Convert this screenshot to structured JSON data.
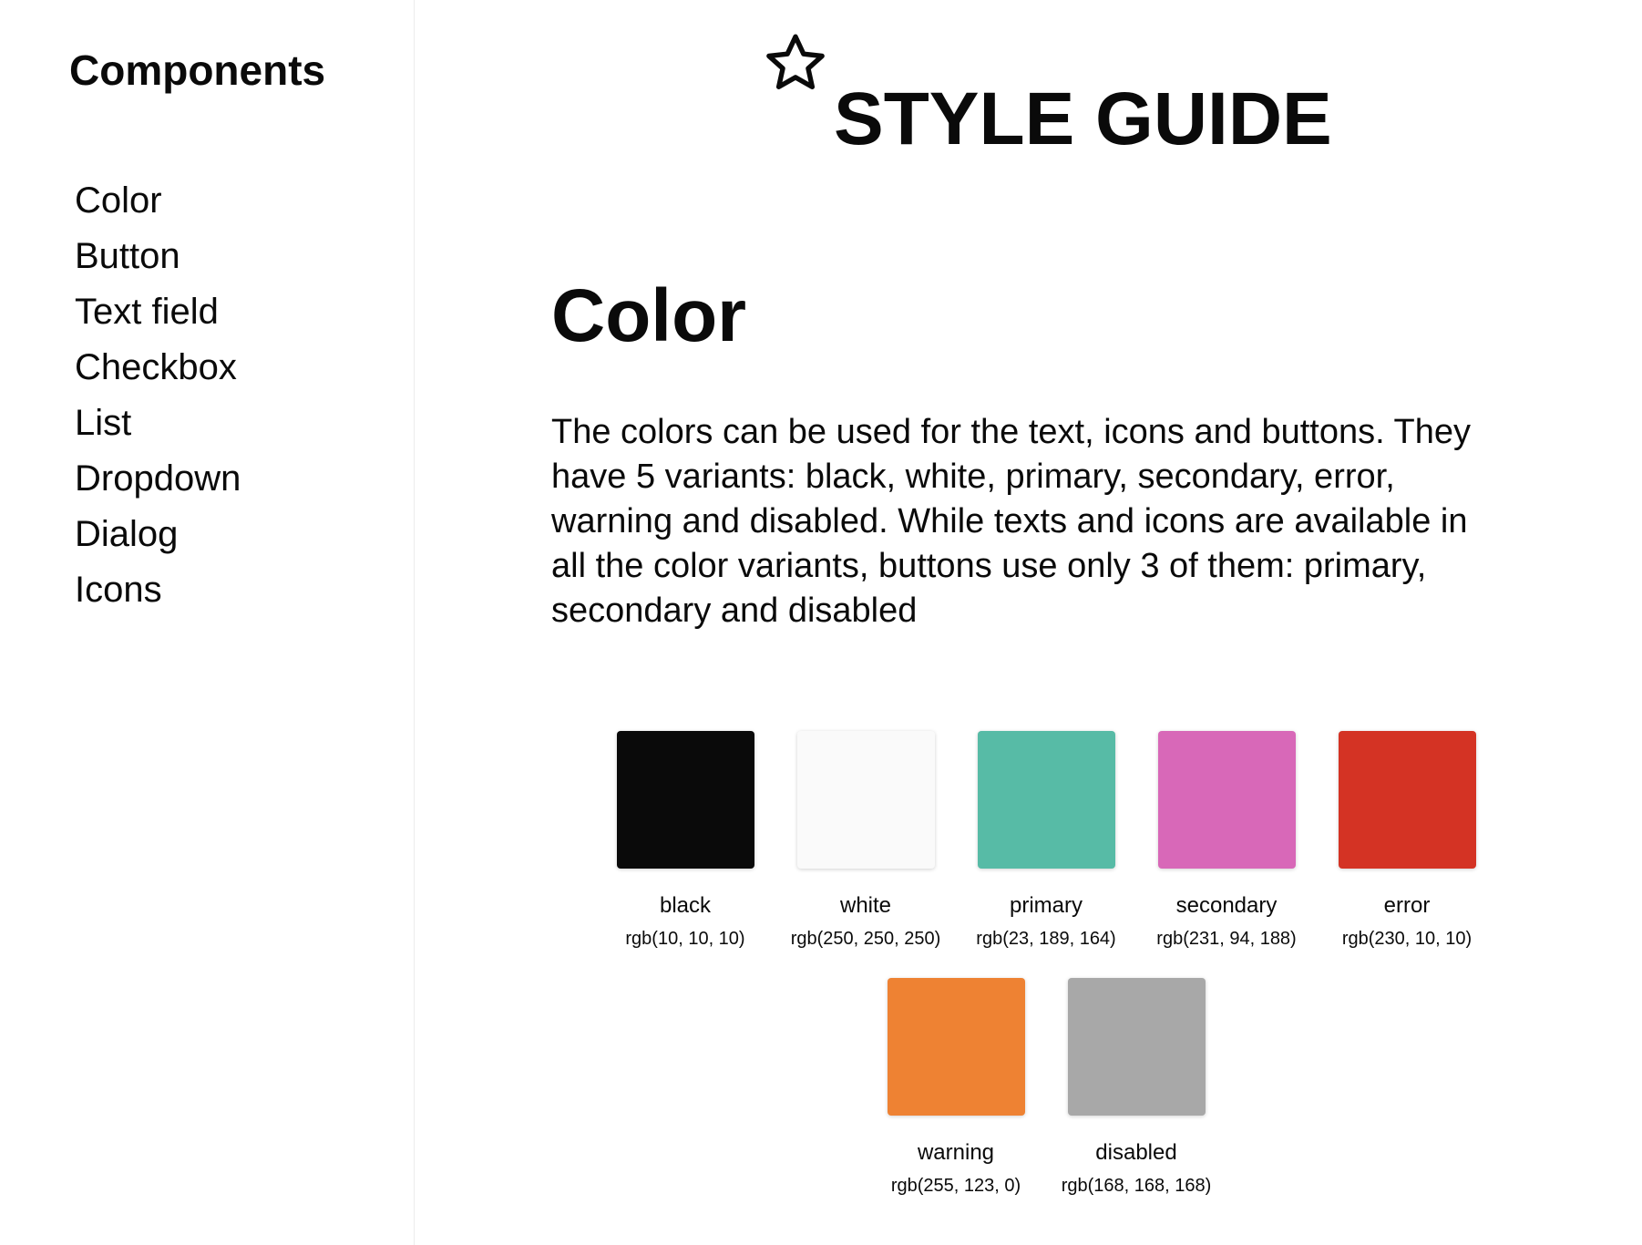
{
  "sidebar": {
    "title": "Components",
    "items": [
      {
        "label": "Color"
      },
      {
        "label": "Button"
      },
      {
        "label": "Text field"
      },
      {
        "label": "Checkbox"
      },
      {
        "label": "List"
      },
      {
        "label": "Dropdown"
      },
      {
        "label": "Dialog"
      },
      {
        "label": "Icons"
      }
    ]
  },
  "header": {
    "icon": "star-outline-icon",
    "title": "STYLE GUIDE"
  },
  "section": {
    "title": "Color",
    "description": "The colors can be used for the text, icons and buttons. They have 5 variants: black, white, primary, secondary, error, warning and disabled. While texts and icons are available in all the color variants, buttons use only 3 of them: primary, secondary and disabled"
  },
  "swatches": [
    {
      "name": "black",
      "value": "rgb(10, 10, 10)",
      "color": "#0a0a0a"
    },
    {
      "name": "white",
      "value": "rgb(250, 250, 250)",
      "color": "#fafafa"
    },
    {
      "name": "primary",
      "value": "rgb(23, 189, 164)",
      "color": "#57bba6"
    },
    {
      "name": "secondary",
      "value": "rgb(231, 94, 188)",
      "color": "#d868b8"
    },
    {
      "name": "error",
      "value": "rgb(230, 10, 10)",
      "color": "#d43324"
    },
    {
      "name": "warning",
      "value": "rgb(255, 123, 0)",
      "color": "#ee8233"
    },
    {
      "name": "disabled",
      "value": "rgb(168, 168, 168)",
      "color": "#a8a8a8"
    }
  ]
}
